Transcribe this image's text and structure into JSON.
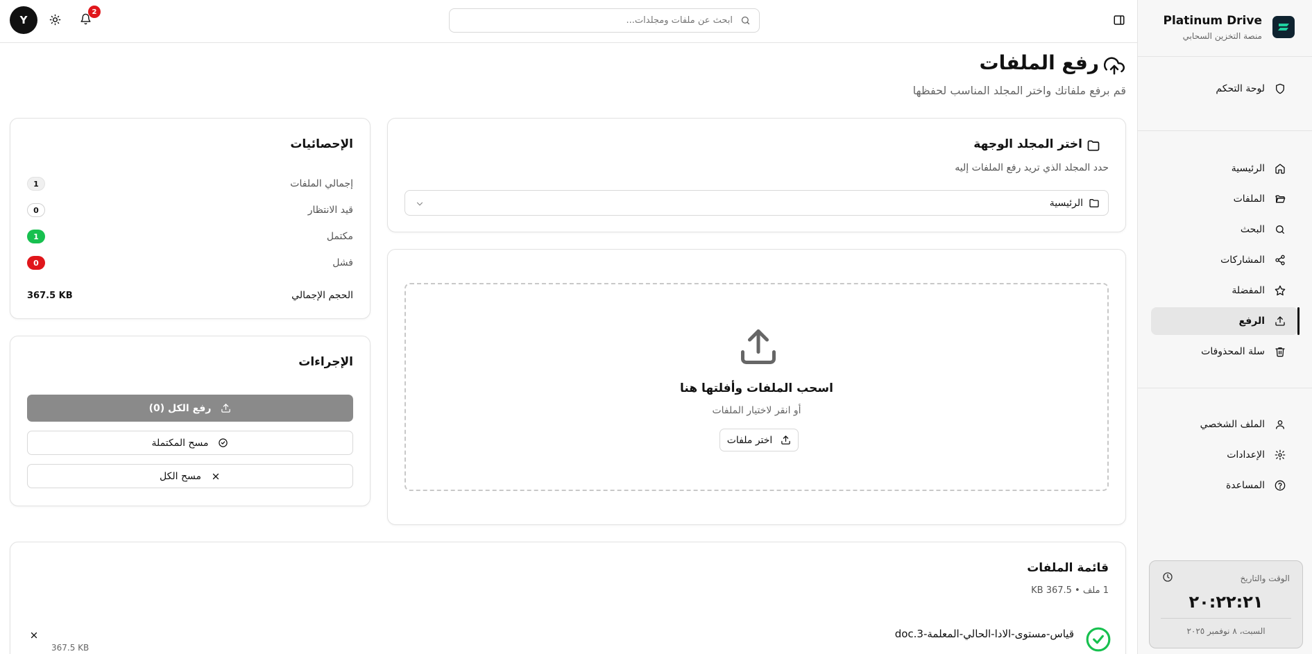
{
  "brand": {
    "name": "Platinum Drive",
    "subtitle": "منصة التخزين السحابي"
  },
  "sidebar": {
    "dashboard": "لوحة التحكم",
    "items": [
      {
        "label": "الرئيسية",
        "icon": "home-icon"
      },
      {
        "label": "الملفات",
        "icon": "folder-open-icon"
      },
      {
        "label": "البحث",
        "icon": "search-icon"
      },
      {
        "label": "المشاركات",
        "icon": "share-icon"
      },
      {
        "label": "المفضلة",
        "icon": "star-icon"
      },
      {
        "label": "الرفع",
        "icon": "upload-icon",
        "active": true
      },
      {
        "label": "سلة المحذوفات",
        "icon": "trash-icon"
      }
    ],
    "bottom_items": [
      {
        "label": "الملف الشخصي",
        "icon": "user-icon"
      },
      {
        "label": "الإعدادات",
        "icon": "gear-icon"
      },
      {
        "label": "المساعدة",
        "icon": "help-icon"
      }
    ],
    "clock": {
      "label": "الوقت والتاريخ",
      "time": "٢٠:٢٢:٢١",
      "date": "السبت، ٨ نوفمبر ٢٠٢٥"
    }
  },
  "header": {
    "search_placeholder": "ابحث عن ملفات ومجلدات...",
    "avatar_initial": "Y",
    "notification_count": "2"
  },
  "page": {
    "title": "رفع الملفات",
    "subtitle": "قم برفع ملفاتك واختر المجلد المناسب لحفظها"
  },
  "folder_card": {
    "title": "اختر المجلد الوجهة",
    "description": "حدد المجلد الذي تريد رفع الملفات إليه",
    "selected_folder": "الرئيسية"
  },
  "dropzone": {
    "title": "اسحب الملفات وأفلتها هنا",
    "subtitle": "أو انقر لاختيار الملفات",
    "button": "اختر ملفات"
  },
  "stats": {
    "title": "الإحصائيات",
    "rows": [
      {
        "label": "إجمالي الملفات",
        "value": "1"
      },
      {
        "label": "قيد الانتظار",
        "value": "0"
      },
      {
        "label": "مكتمل",
        "value": "1"
      },
      {
        "label": "فشل",
        "value": "0"
      }
    ],
    "total_size_label": "الحجم الإجمالي",
    "total_size_value": "367.5 KB"
  },
  "actions": {
    "title": "الإجراءات",
    "upload_all": "رفع الكل (0)",
    "clear_completed": "مسح المكتملة",
    "clear_all": "مسح الكل"
  },
  "files": {
    "title": "قائمة الملفات",
    "meta": "1 ملف • 367.5 KB",
    "items": [
      {
        "name": "قياس-مستوى-الادا-الحالي-المعلمة-3.doc",
        "size": "367.5 KB",
        "status": "completed"
      }
    ]
  },
  "colors": {
    "success": "#17c04f",
    "danger": "#e0161b",
    "logo_bg": "#0f2330",
    "logo_accent": "#1fd1a0"
  }
}
